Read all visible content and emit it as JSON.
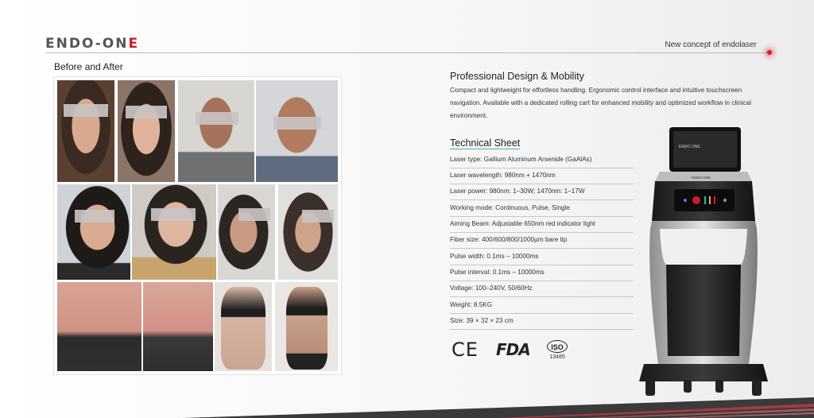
{
  "header": {
    "logo_text": "ENDO-ON",
    "logo_accent": "E",
    "tagline": "New concept of endolaser",
    "accent_color": "#d21e28"
  },
  "before_after": {
    "title": "Before and After"
  },
  "design": {
    "title": "Professional Design & Mobility",
    "body": "Compact and lightweight for effortless handling. Ergonomic control interface and intuitive touchscreen navigation. Available with a dedicated rolling cart for enhanced mobility and optimized workflow in clinical environment."
  },
  "technical": {
    "title": "Technical Sheet",
    "specs": [
      "Laser type: Gallium Aluminum Arsenide (GaAlAs)",
      "Laser wavelength: 980nm + 1470nm",
      "Laser power: 980nm: 1–30W; 1470nm: 1–17W",
      "Working mode: Continuous, Pulse, Single",
      "Aiming Beam: Adjustable 650nm red indicator light",
      "Fiber size: 400/600/800/1000µm bare tip",
      "Pulse width: 0.1ms – 10000ms",
      "Pulse interval: 0.1ms – 10000ms",
      "Voltage: 100–240V, 50/60Hz",
      "Weight: 8.5KG",
      "Size: 39 × 32 × 23 cm"
    ]
  },
  "certifications": {
    "ce": "CE",
    "fda": "FDA",
    "iso": "ISO",
    "iso_number": "13485"
  },
  "device": {
    "screen_text": "ENDO ONE",
    "brand_text": "ENDO-ONE"
  }
}
